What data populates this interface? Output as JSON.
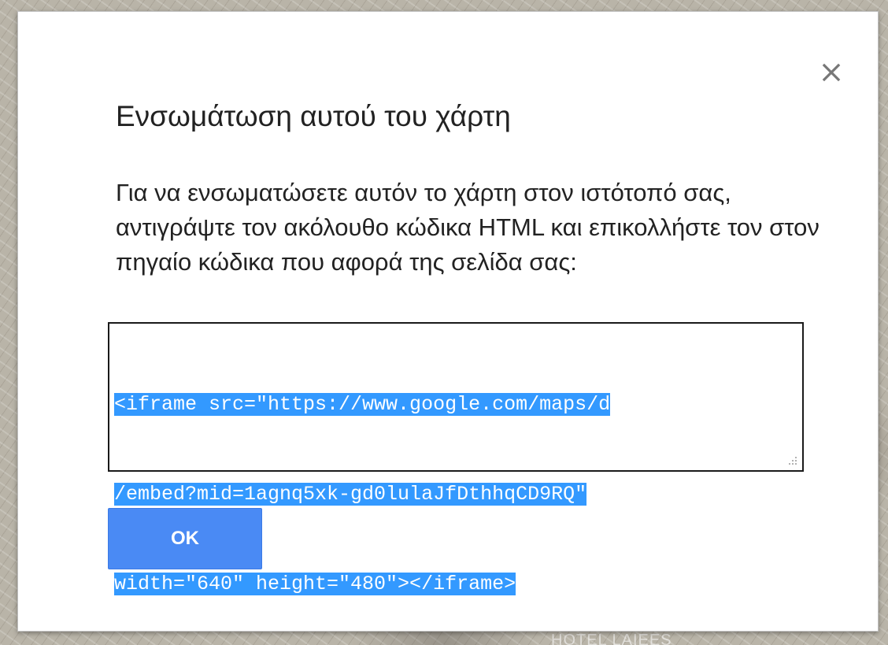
{
  "background": {
    "map_label": "HOTEL LAIEES"
  },
  "dialog": {
    "title": "Ενσωμάτωση αυτού του χάρτη",
    "description": "Για να ενσωματώσετε αυτόν το χάρτη στον ιστότοπό σας, αντιγράψτε τον ακόλουθο κώδικα HTML και επικολλήστε τον στον πηγαίο κώδικα που αφορά της σελίδα σας:",
    "code_lines": [
      "<iframe src=\"https://www.google.com/maps/d",
      "/embed?mid=1agnq5xk-gd0lulaJfDthhqCD9RQ\"",
      "width=\"640\" height=\"480\"></iframe>"
    ],
    "ok_label": "OK",
    "close_icon": "close-icon"
  },
  "colors": {
    "accent": "#4a8af4",
    "selection": "#3399ff",
    "title_text": "#222222"
  }
}
